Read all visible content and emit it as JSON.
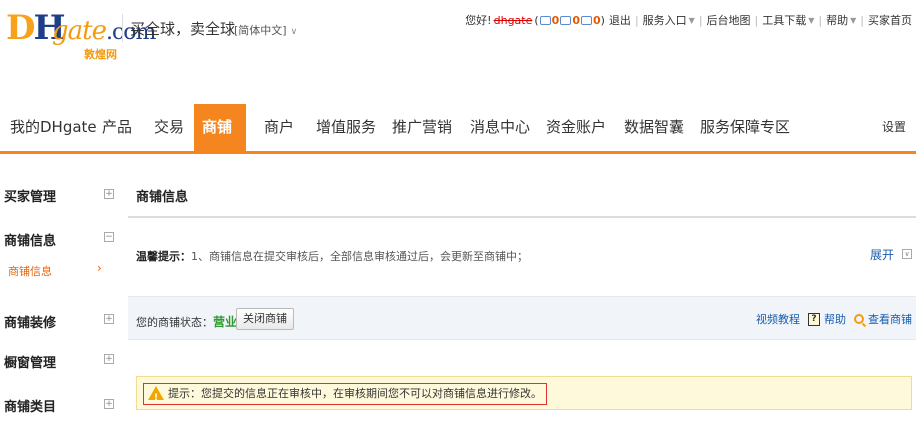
{
  "header": {
    "logo_text": "DHgate.com",
    "logo_sub": "敦煌网",
    "slogan": "买全球，卖全球",
    "language": "[简体中文]",
    "greeting": "您好!",
    "username": "dhgate",
    "msg_count": "0",
    "chat_count": "0",
    "notice_count": "0",
    "logout": "退出",
    "service_entry": "服务入口",
    "backend_map": "后台地图",
    "tools_download": "工具下载",
    "help": "帮助",
    "buyer_home": "买家首页"
  },
  "nav": {
    "items": [
      {
        "label": "我的DHgate"
      },
      {
        "label": "产品"
      },
      {
        "label": "交易"
      },
      {
        "label": "商铺",
        "active": true
      },
      {
        "label": "商户"
      },
      {
        "label": "增值服务"
      },
      {
        "label": "推广营销"
      },
      {
        "label": "消息中心"
      },
      {
        "label": "资金账户"
      },
      {
        "label": "数据智囊"
      },
      {
        "label": "服务保障专区"
      }
    ],
    "settings": "设置"
  },
  "sidebar": {
    "groups": [
      {
        "title": "买家管理",
        "toggle": "+"
      },
      {
        "title": "商铺信息",
        "toggle": "−",
        "sub": "商铺信息"
      },
      {
        "title": "商铺装修",
        "toggle": "+"
      },
      {
        "title": "橱窗管理",
        "toggle": "+"
      },
      {
        "title": "商铺类目",
        "toggle": "+"
      }
    ]
  },
  "main": {
    "title": "商铺信息",
    "tip_label": "温馨提示：",
    "tip_text": "1、商铺信息在提交审核后，全部信息审核通过后，会更新至商铺中；",
    "expand": "展开",
    "status_label": "您的商铺状态：",
    "status_value": "营业中",
    "close_button": "关闭商铺",
    "video_tutorial": "视频教程",
    "help": "帮助",
    "view_shop": "查看商铺",
    "warning": "提示：您提交的信息正在审核中，在审核期间您不可以对商铺信息进行修改。"
  },
  "colors": {
    "accent": "#f5851f",
    "status_green": "#2e9b2e",
    "link_blue": "#1a5dab",
    "warning_bg": "#fff9dc"
  }
}
